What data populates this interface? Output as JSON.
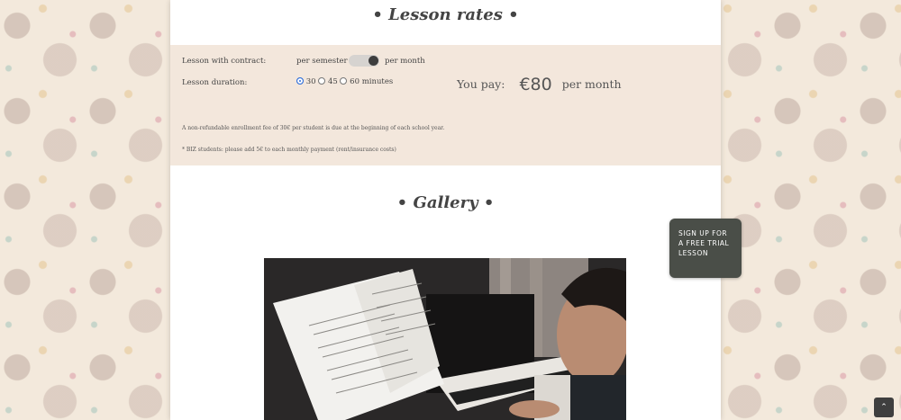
{
  "rates": {
    "title": "• Lesson rates •",
    "contract_label": "Lesson with contract:",
    "per_semester": "per semester",
    "per_month": "per month",
    "toggle_value": "per month",
    "duration_label": "Lesson duration:",
    "duration_options": [
      "30",
      "45",
      "60 minutes"
    ],
    "duration_selected": "30",
    "you_pay_label": "You pay:",
    "price": "€80",
    "price_unit": "per month",
    "note_enrollment": "A non-refundable enrollment fee of 30€ per student is due at the beginning of each school year.",
    "note_biz": "* BIZ students: please add 5€ to each monthly payment (rent/insurance costs)"
  },
  "gallery": {
    "title": "• Gallery •"
  },
  "cta": {
    "label": "Sign up for a free trial lesson"
  },
  "scroll_top": {
    "icon": "chevron-up-icon",
    "glyph": "⌃"
  },
  "colors": {
    "rates_bg": "#f3e7dc",
    "cta_bg": "#4a4e48",
    "radio_accent": "#2b6bd8"
  }
}
